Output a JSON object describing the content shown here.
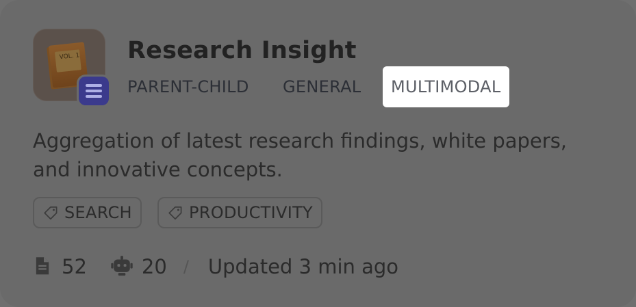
{
  "card": {
    "title": "Research Insight",
    "modes": [
      "PARENT-CHILD",
      "GENERAL",
      "MULTIMODAL"
    ],
    "active_mode": "MULTIMODAL",
    "description": "Aggregation of latest research findings, white papers, and innovative concepts.",
    "tags": [
      "SEARCH",
      "PRODUCTIVITY"
    ],
    "stats": {
      "documents": "52",
      "apps": "20",
      "separator": "/",
      "updated": "Updated 3 min ago"
    },
    "icon": {
      "book_label": "VOL. 1",
      "badge": "list-icon"
    }
  }
}
